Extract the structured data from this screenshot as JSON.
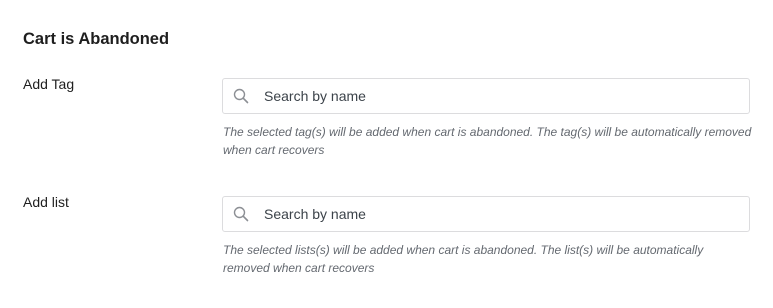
{
  "section": {
    "title": "Cart is Abandoned"
  },
  "fields": [
    {
      "label": "Add Tag",
      "search_placeholder": "Search by name",
      "search_value": "",
      "search_icon": "search-icon",
      "help_text": "The selected tag(s) will be added when cart is abandoned. The tag(s) will be automatically removed when cart recovers"
    },
    {
      "label": "Add list",
      "search_placeholder": "Search by name",
      "search_value": "",
      "search_icon": "search-icon",
      "help_text": "The selected lists(s) will be added when cart is abandoned. The list(s) will be automatically removed when cart recovers"
    }
  ],
  "colors": {
    "text": "#1e1e1e",
    "help_text": "#646970",
    "border": "#dcdcde",
    "icon": "#8c8f94"
  }
}
